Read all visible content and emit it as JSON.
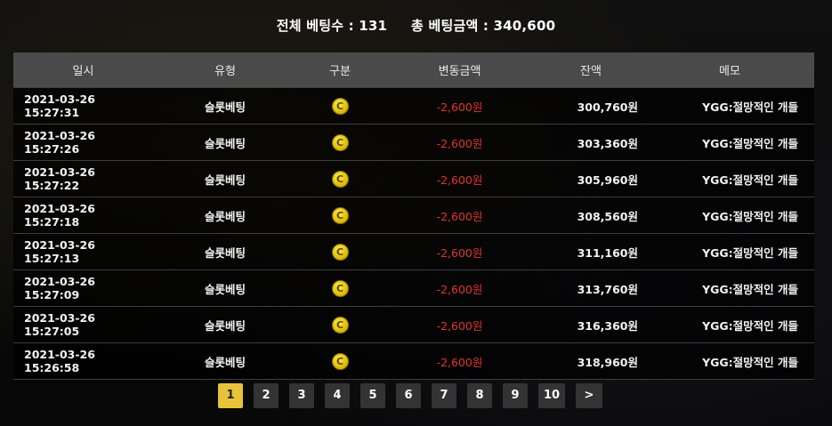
{
  "summary": {
    "total_bets_label": "전체 베팅수 : 131",
    "total_amount_label": "총 베팅금액 : 340,600"
  },
  "columns": [
    "일시",
    "유형",
    "구분",
    "변동금액",
    "잔액",
    "메모"
  ],
  "rows": [
    {
      "datetime": "2021-03-26 15:27:31",
      "type": "슬롯베팅",
      "category_icon": "coin-icon",
      "amount": "-2,600원",
      "balance": "300,760원",
      "memo": "YGG:절망적인 개들"
    },
    {
      "datetime": "2021-03-26 15:27:26",
      "type": "슬롯베팅",
      "category_icon": "coin-icon",
      "amount": "-2,600원",
      "balance": "303,360원",
      "memo": "YGG:절망적인 개들"
    },
    {
      "datetime": "2021-03-26 15:27:22",
      "type": "슬롯베팅",
      "category_icon": "coin-icon",
      "amount": "-2,600원",
      "balance": "305,960원",
      "memo": "YGG:절망적인 개들"
    },
    {
      "datetime": "2021-03-26 15:27:18",
      "type": "슬롯베팅",
      "category_icon": "coin-icon",
      "amount": "-2,600원",
      "balance": "308,560원",
      "memo": "YGG:절망적인 개들"
    },
    {
      "datetime": "2021-03-26 15:27:13",
      "type": "슬롯베팅",
      "category_icon": "coin-icon",
      "amount": "-2,600원",
      "balance": "311,160원",
      "memo": "YGG:절망적인 개들"
    },
    {
      "datetime": "2021-03-26 15:27:09",
      "type": "슬롯베팅",
      "category_icon": "coin-icon",
      "amount": "-2,600원",
      "balance": "313,760원",
      "memo": "YGG:절망적인 개들"
    },
    {
      "datetime": "2021-03-26 15:27:05",
      "type": "슬롯베팅",
      "category_icon": "coin-icon",
      "amount": "-2,600원",
      "balance": "316,360원",
      "memo": "YGG:절망적인 개들"
    },
    {
      "datetime": "2021-03-26 15:26:58",
      "type": "슬롯베팅",
      "category_icon": "coin-icon",
      "amount": "-2,600원",
      "balance": "318,960원",
      "memo": "YGG:절망적인 개들"
    }
  ],
  "coin_glyph": "C",
  "pagination": {
    "pages": [
      "1",
      "2",
      "3",
      "4",
      "5",
      "6",
      "7",
      "8",
      "9",
      "10"
    ],
    "current": "1",
    "next_label": ">"
  },
  "colors": {
    "header_bg": "#4a4a4a",
    "negative_amount": "#e0352b",
    "active_page": "#e8c23a",
    "coin": "#e8c800"
  }
}
